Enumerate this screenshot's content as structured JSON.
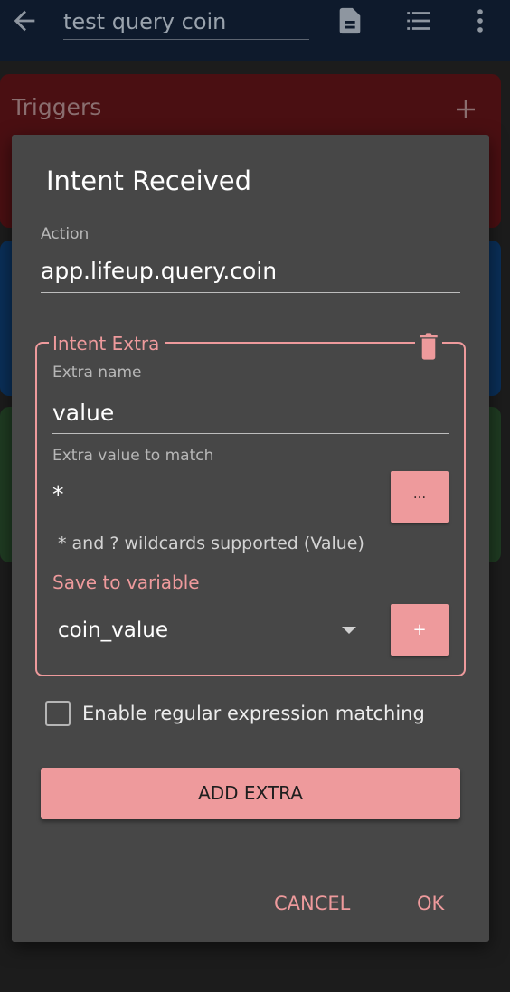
{
  "appbar": {
    "title": "test query coin",
    "icons": [
      "arrow-back-icon",
      "document-icon",
      "list-icon",
      "more-vert-icon"
    ]
  },
  "cards": {
    "triggers_title": "Triggers",
    "add_icon": "plus-icon"
  },
  "dialog": {
    "title": "Intent Received",
    "action_label": "Action",
    "action_value": "app.lifeup.query.coin",
    "extra": {
      "legend": "Intent Extra",
      "name_label": "Extra name",
      "name_value": "value",
      "match_label": "Extra value to match",
      "match_value": "*",
      "more_button": "...",
      "wildcard_hint": "* and ? wildcards supported (Value)",
      "save_label": "Save to variable",
      "variable_value": "coin_value",
      "add_variable_button": "+"
    },
    "regex_label": "Enable regular expression matching",
    "regex_checked": false,
    "add_extra_button": "ADD EXTRA",
    "cancel_button": "CANCEL",
    "ok_button": "OK"
  },
  "colors": {
    "accent": "#ee9a9c",
    "dialog_bg": "#474747",
    "triggers_card": "#4a0f12",
    "actions_card": "#0a2f58",
    "constraints_card": "#1f3b22",
    "appbar": "#0e1a2c"
  }
}
